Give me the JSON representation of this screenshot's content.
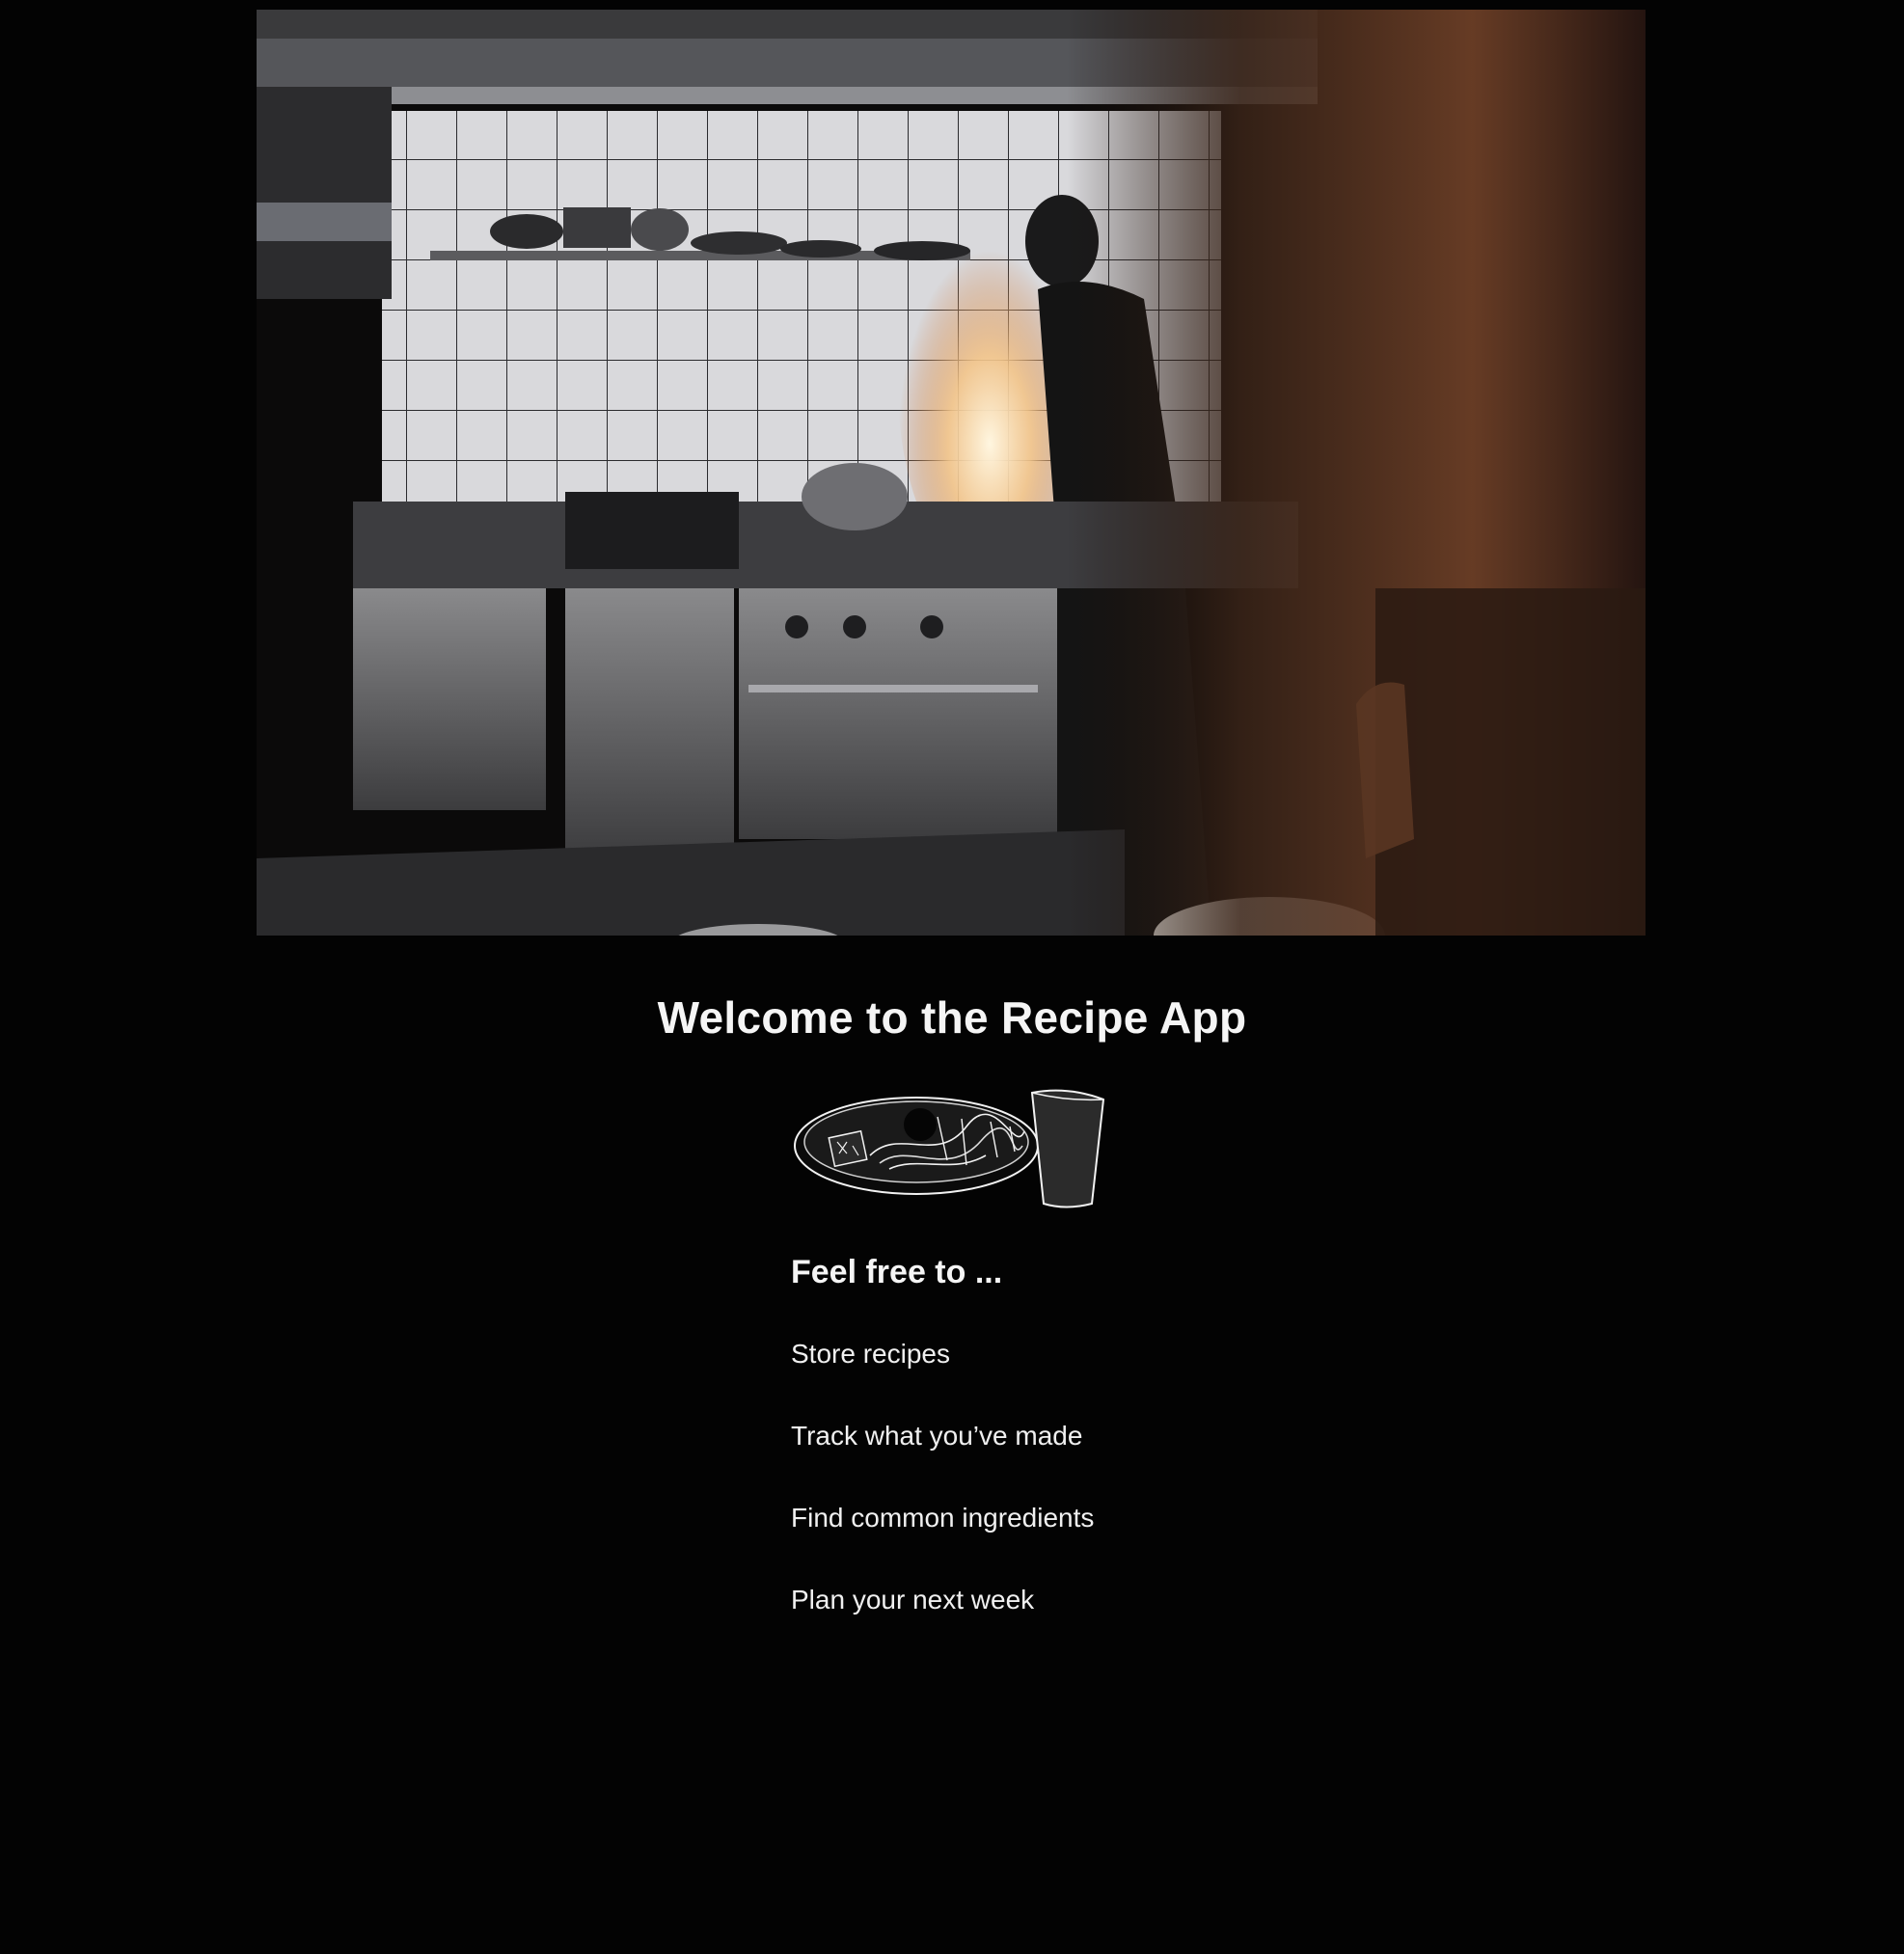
{
  "hero": {
    "alt": "Chef flambéing in a restaurant kitchen"
  },
  "welcome": {
    "title": "Welcome to the Recipe App"
  },
  "illustration": {
    "icon": "plate-and-cup-icon"
  },
  "features": {
    "heading": "Feel free to ...",
    "items": [
      "Store recipes",
      "Track what you’ve made",
      "Find common ingredients",
      "Plan your next week"
    ]
  }
}
